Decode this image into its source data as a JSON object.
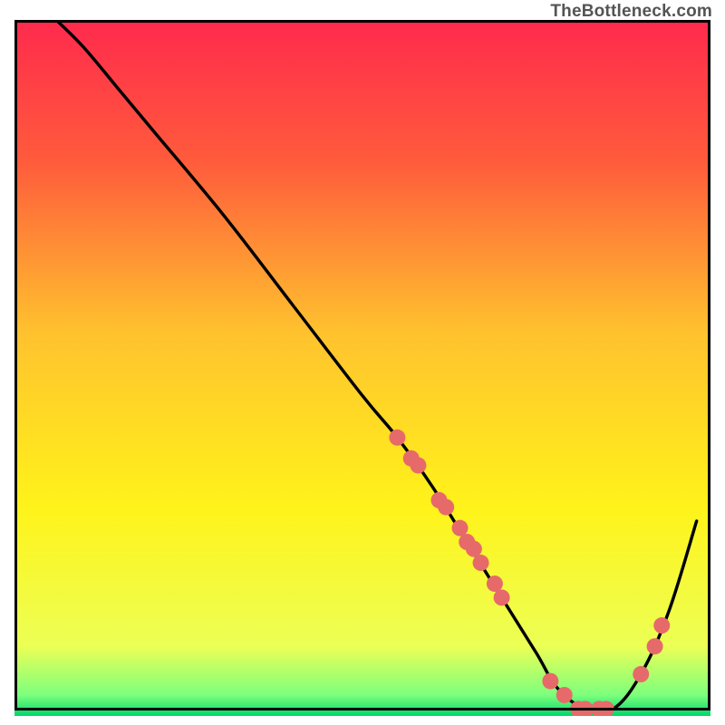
{
  "watermark": "TheBottleneck.com",
  "chart_data": {
    "type": "line",
    "title": "",
    "xlabel": "",
    "ylabel": "",
    "xlim": [
      0,
      100
    ],
    "ylim": [
      0,
      100
    ],
    "gradient_stops": [
      {
        "offset": 0,
        "color": "#ff2a4d"
      },
      {
        "offset": 20,
        "color": "#ff5a3c"
      },
      {
        "offset": 45,
        "color": "#ffc22e"
      },
      {
        "offset": 70,
        "color": "#fff31a"
      },
      {
        "offset": 90,
        "color": "#ecff55"
      },
      {
        "offset": 97,
        "color": "#7dff7d"
      },
      {
        "offset": 100,
        "color": "#00d66b"
      }
    ],
    "series": [
      {
        "name": "bottleneck-curve",
        "x": [
          6,
          10,
          15,
          20,
          30,
          40,
          50,
          55,
          60,
          65,
          70,
          75,
          78,
          82,
          86,
          90,
          94,
          98
        ],
        "y": [
          100,
          96,
          90,
          84,
          72,
          59,
          46,
          40,
          33,
          25,
          17,
          9,
          4,
          1,
          1,
          6,
          15,
          28
        ]
      }
    ],
    "markers": {
      "name": "highlight-points",
      "color": "#e66a6a",
      "radius": 9,
      "points": [
        {
          "x": 55,
          "y": 40
        },
        {
          "x": 57,
          "y": 37
        },
        {
          "x": 58,
          "y": 36
        },
        {
          "x": 61,
          "y": 31
        },
        {
          "x": 62,
          "y": 30
        },
        {
          "x": 64,
          "y": 27
        },
        {
          "x": 65,
          "y": 25
        },
        {
          "x": 66,
          "y": 24
        },
        {
          "x": 67,
          "y": 22
        },
        {
          "x": 69,
          "y": 19
        },
        {
          "x": 70,
          "y": 17
        },
        {
          "x": 77,
          "y": 5
        },
        {
          "x": 79,
          "y": 3
        },
        {
          "x": 81,
          "y": 1
        },
        {
          "x": 82,
          "y": 1
        },
        {
          "x": 84,
          "y": 1
        },
        {
          "x": 85,
          "y": 1
        },
        {
          "x": 90,
          "y": 6
        },
        {
          "x": 92,
          "y": 10
        },
        {
          "x": 93,
          "y": 13
        }
      ]
    }
  }
}
